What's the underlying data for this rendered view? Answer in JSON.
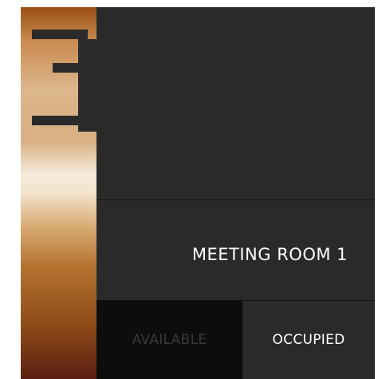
{
  "room": {
    "name": "MEETING ROOM 1"
  },
  "status": {
    "available_label": "AVAILABLE",
    "occupied_label": "OCCUPIED",
    "current": "OCCUPIED"
  },
  "logo": {
    "icon": "e-bracket-logo-icon"
  },
  "colors": {
    "panel": "#2a2a2a",
    "available_bg": "#0d0d0d",
    "occupied_text": "#ffffff",
    "accent_top": "#9a4f16",
    "accent_mid": "#f6ebdc",
    "accent_bottom": "#5a1f12"
  }
}
